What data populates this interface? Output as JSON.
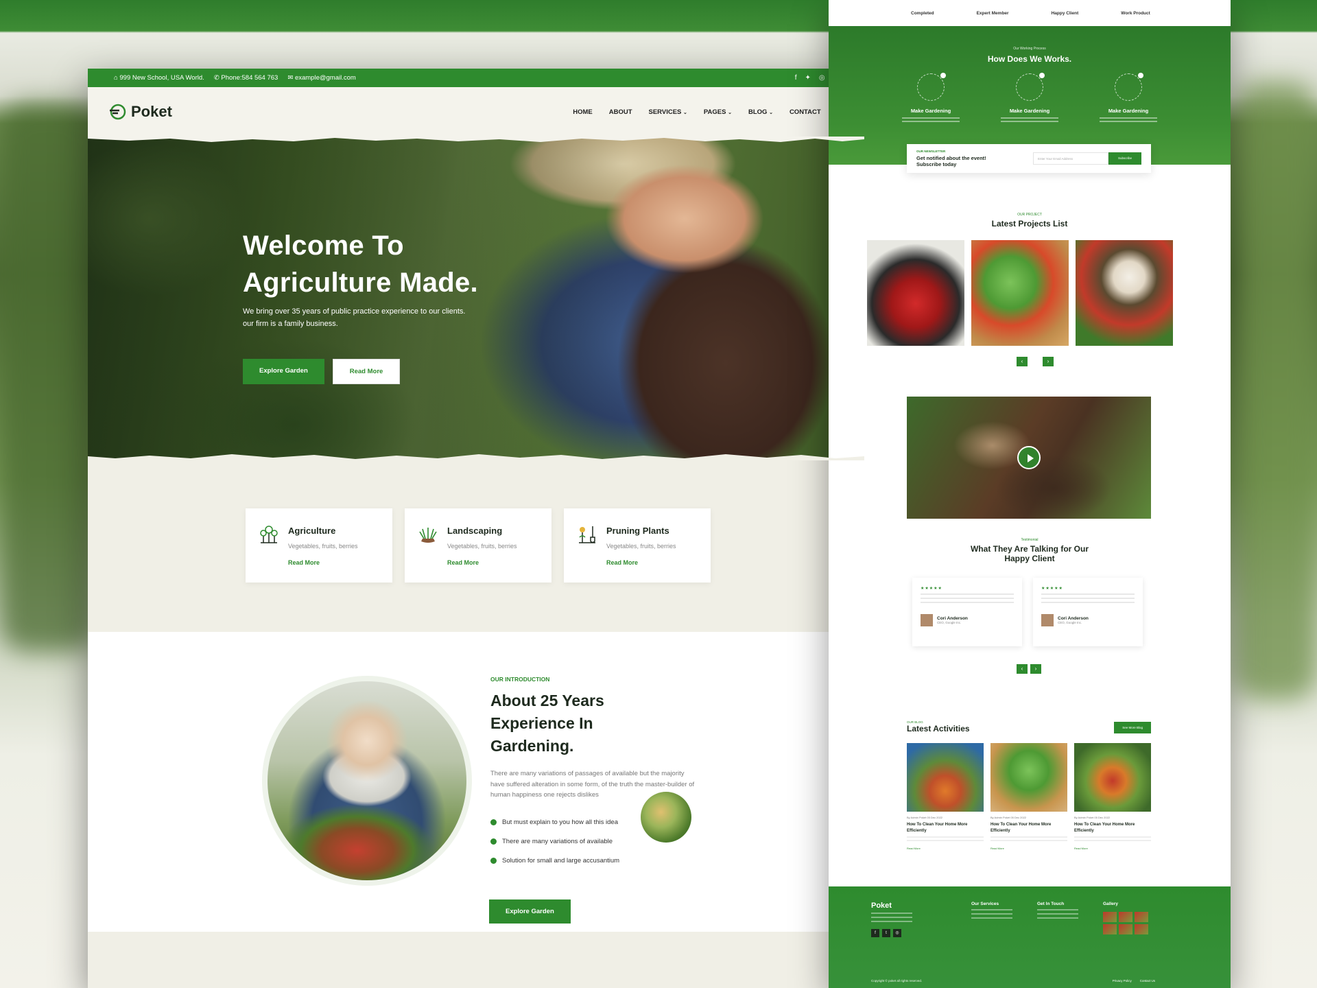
{
  "left": {
    "topbar": {
      "address": "999 New School, USA World.",
      "phone": "Phone:584 564 763",
      "email": "example@gmail.com",
      "social": [
        "f",
        "t",
        "ig",
        "p"
      ]
    },
    "brand": {
      "name": "Poket"
    },
    "menu": [
      "HOME",
      "ABOUT",
      "SERVICES",
      "PAGES",
      "BLOG",
      "CONTACT"
    ],
    "hero": {
      "title_line1": "Welcome To",
      "title_line2": "Agriculture Made.",
      "text_line1": "We bring over 35 years of public practice experience to our clients.",
      "text_line2": "our firm is a family business.",
      "btn_primary": "Explore Garden",
      "btn_secondary": "Read More"
    },
    "services": [
      {
        "title": "Agriculture",
        "sub": "Vegetables, fruits, berries",
        "link": "Read More",
        "icon": "plants-icon"
      },
      {
        "title": "Landscaping",
        "sub": "Vegetables, fruits, berries",
        "link": "Read More",
        "icon": "grass-icon"
      },
      {
        "title": "Pruning Plants",
        "sub": "Vegetables, fruits, berries",
        "link": "Read More",
        "icon": "shovel-icon"
      }
    ],
    "about": {
      "label": "OUR INTRODUCTION",
      "title_l1": "About 25 Years",
      "title_l2": "Experience In",
      "title_l3": "Gardening.",
      "para": "There are many variations of passages of available but the majority have suffered alteration in some form, of the truth the master-builder of human happiness one rejects dislikes",
      "checks": [
        "But must explain to you how all this idea",
        "There are many variations of available",
        "Solution for small and large accusantium"
      ],
      "button": "Explore Garden"
    }
  },
  "right": {
    "stats": [
      "Completed",
      "Expert Member",
      "Happy Client",
      "Work Product"
    ],
    "works": {
      "label": "Our Working Process",
      "title": "How Does We Works.",
      "steps": [
        "Make Gardening",
        "Make Gardening",
        "Make Gardening"
      ]
    },
    "newsletter": {
      "label": "OUR NEWSLETTER",
      "title": "Get notified about the event! Subscribe today",
      "placeholder": "Enter Your Email Address",
      "button": "Subscribe"
    },
    "projects": {
      "label": "OUR PROJECT",
      "title": "Latest Projects List"
    },
    "testimonials": {
      "label": "Testimonial",
      "title_l1": "What They Are Talking for Our",
      "title_l2": "Happy Client",
      "items": [
        {
          "name": "Cori Anderson",
          "role": "CEO, Google Inc."
        },
        {
          "name": "Cori Anderson",
          "role": "CEO, Google Inc."
        }
      ]
    },
    "blog": {
      "label": "OUR BLOG",
      "title": "Latest Activities",
      "button": "See More Blog",
      "posts": [
        {
          "meta": "By Admin Poket   05 Dec 2022",
          "title": "How To Clean Your Home More Efficiently",
          "link": "Read More"
        },
        {
          "meta": "By Admin Poket   05 Dec 2022",
          "title": "How To Clean Your Home More Efficiently",
          "link": "Read More"
        },
        {
          "meta": "By Admin Poket   05 Dec 2022",
          "title": "How To Clean Your Home More Efficiently",
          "link": "Read More"
        }
      ]
    },
    "footer": {
      "brand": "Poket",
      "col1": "Our Services",
      "col2": "Get In Touch",
      "col3": "Gallery",
      "copyright": "Copyright © poket all rights reserved.",
      "links": [
        "Privacy Policy",
        "Contact Us"
      ]
    }
  },
  "colors": {
    "brand_green": "#2e8b2e",
    "dark_text": "#1e2a1e"
  }
}
